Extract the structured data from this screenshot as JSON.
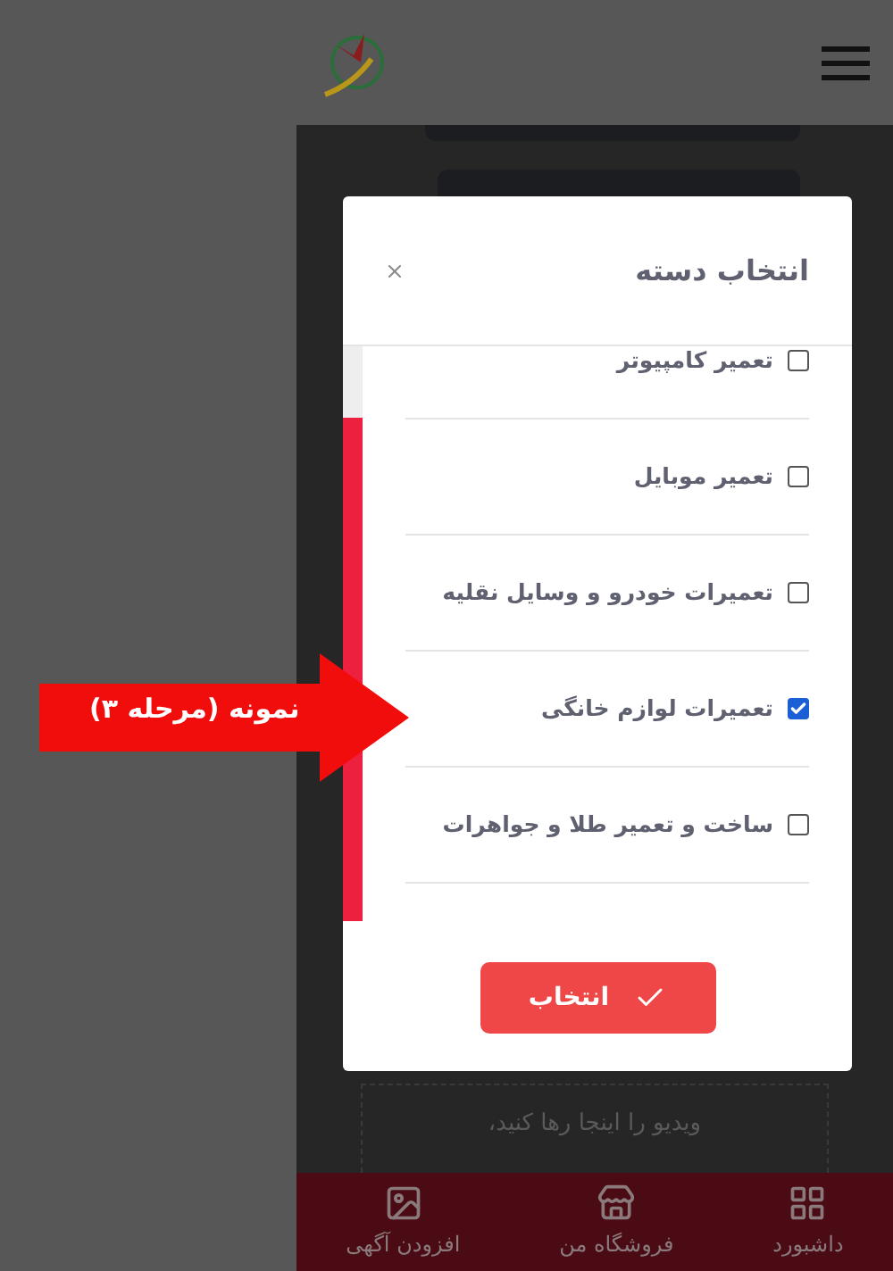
{
  "modal": {
    "title": "انتخاب دسته",
    "items": [
      {
        "label": "تعمیر کامپیوتر",
        "checked": false
      },
      {
        "label": "تعمیر موبایل",
        "checked": false
      },
      {
        "label": "تعمیرات خودرو و وسایل نقلیه",
        "checked": false
      },
      {
        "label": "تعمیرات لوازم خانگی",
        "checked": true
      },
      {
        "label": "ساخت و تعمیر طلا و جواهرات",
        "checked": false
      }
    ],
    "button": "انتخاب"
  },
  "drop_zone": {
    "text": "ویدیو را اینجا رها کنید،"
  },
  "bottom_nav": [
    {
      "label": "داشبورد",
      "kind": "dashboard"
    },
    {
      "label": "فروشگاه من",
      "kind": "store"
    },
    {
      "label": "افزودن آگهی",
      "kind": "image"
    }
  ],
  "annotation": {
    "text": "نمونه (مرحله ۳)"
  }
}
